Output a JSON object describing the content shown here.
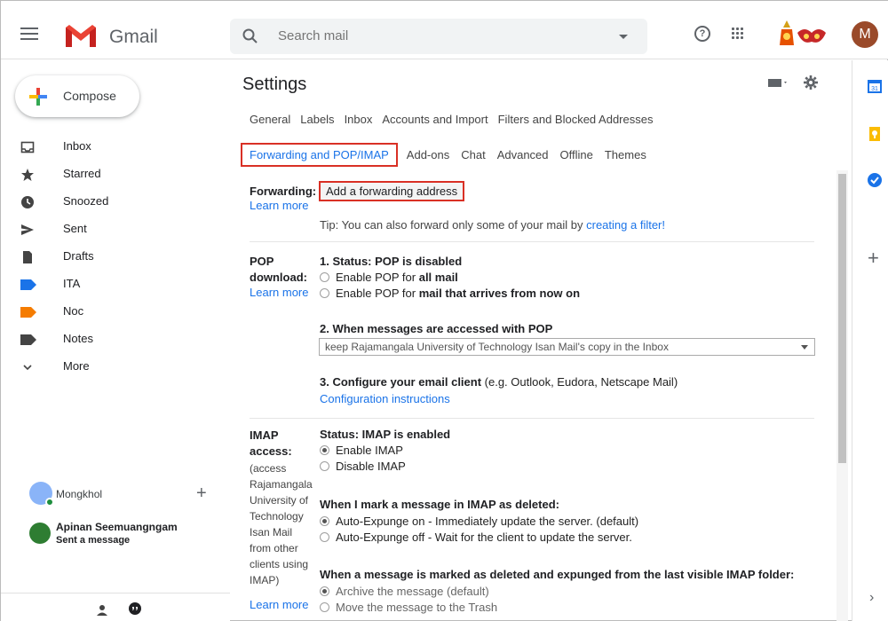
{
  "header": {
    "app_name": "Gmail",
    "search_placeholder": "Search mail",
    "avatar_letter": "M"
  },
  "sidebar": {
    "compose_label": "Compose",
    "items": [
      {
        "label": "Inbox",
        "icon": "inbox-icon"
      },
      {
        "label": "Starred",
        "icon": "star-icon"
      },
      {
        "label": "Snoozed",
        "icon": "clock-icon"
      },
      {
        "label": "Sent",
        "icon": "send-icon"
      },
      {
        "label": "Drafts",
        "icon": "draft-icon"
      },
      {
        "label": "ITA",
        "icon": "label-icon",
        "color": "#1a73e8"
      },
      {
        "label": "Noc",
        "icon": "label-icon",
        "color": "#f57c00"
      },
      {
        "label": "Notes",
        "icon": "label-icon",
        "color": "#444444"
      },
      {
        "label": "More",
        "icon": "chevron-down-icon"
      }
    ],
    "account_name": "Mongkhol",
    "hangout_name": "Apinan Seemuangngam",
    "hangout_status": "Sent a message"
  },
  "main": {
    "title": "Settings",
    "tabs_row1": [
      "General",
      "Labels",
      "Inbox",
      "Accounts and Import",
      "Filters and Blocked Addresses"
    ],
    "tab_active": "Forwarding and POP/IMAP",
    "tabs_row2": [
      "Add-ons",
      "Chat",
      "Advanced",
      "Offline",
      "Themes"
    ],
    "forwarding": {
      "label": "Forwarding:",
      "learn_more": "Learn more",
      "button": "Add a forwarding address",
      "tip_prefix": "Tip: You can also forward only some of your mail by ",
      "tip_link": "creating a filter!"
    },
    "pop": {
      "label_line1": "POP",
      "label_line2": "download:",
      "learn_more": "Learn more",
      "status": "1. Status: POP is disabled",
      "opt1_prefix": "Enable POP for ",
      "opt1_bold": "all mail",
      "opt2_prefix": "Enable POP for ",
      "opt2_bold": "mail that arrives from now on",
      "step2": "2. When messages are accessed with POP",
      "select_value": "keep Rajamangala University of Technology Isan Mail's copy in the Inbox",
      "step3_bold": "3. Configure your email client",
      "step3_rest": " (e.g. Outlook, Eudora, Netscape Mail)",
      "config_link": "Configuration instructions"
    },
    "imap": {
      "label_line1": "IMAP",
      "label_line2": "access:",
      "side_note": "(access Rajamangala University of Technology Isan Mail from other clients using IMAP)",
      "learn_more": "Learn more",
      "status_prefix": "Status: ",
      "status_value": "IMAP is enabled",
      "enable": "Enable IMAP",
      "disable": "Disable IMAP",
      "deleted_heading": "When I mark a message in IMAP as deleted:",
      "expunge_on": "Auto-Expunge on - Immediately update the server. (default)",
      "expunge_off": "Auto-Expunge off - Wait for the client to update the server.",
      "expunged_heading": "When a message is marked as deleted and expunged from the last visible IMAP folder:",
      "archive": "Archive the message (default)",
      "trash": "Move the message to the Trash"
    }
  },
  "colors": {
    "accent": "#1a73e8",
    "highlight_box": "#d93025",
    "imap_enabled": "#188038"
  }
}
